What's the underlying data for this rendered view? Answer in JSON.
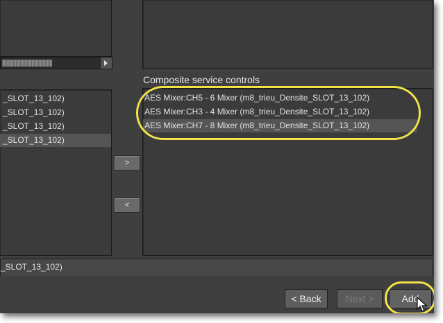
{
  "left_list": {
    "items": [
      {
        "label": "_SLOT_13_102)",
        "selected": false
      },
      {
        "label": "_SLOT_13_102)",
        "selected": false
      },
      {
        "label": "_SLOT_13_102)",
        "selected": false
      },
      {
        "label": "_SLOT_13_102)",
        "selected": true
      }
    ]
  },
  "move_buttons": {
    "add_label": ">",
    "remove_label": "<"
  },
  "composite": {
    "title": "Composite service controls",
    "items": [
      {
        "label": "AES Mixer:CH5 - 6 Mixer (m8_trieu_Densite_SLOT_13_102)",
        "selected": false
      },
      {
        "label": "AES Mixer:CH3 - 4 Mixer (m8_trieu_Densite_SLOT_13_102)",
        "selected": false
      },
      {
        "label": "AES Mixer:CH7 - 8 Mixer (m8_trieu_Densite_SLOT_13_102)",
        "selected": true
      }
    ]
  },
  "status_text": "_SLOT_13_102)",
  "buttons": {
    "back": "< Back",
    "next": "Next >",
    "add": "Add"
  },
  "colors": {
    "highlight_ring": "#f2e24a",
    "panel_bg": "#3b3b3b",
    "selected_row": "#555555"
  }
}
